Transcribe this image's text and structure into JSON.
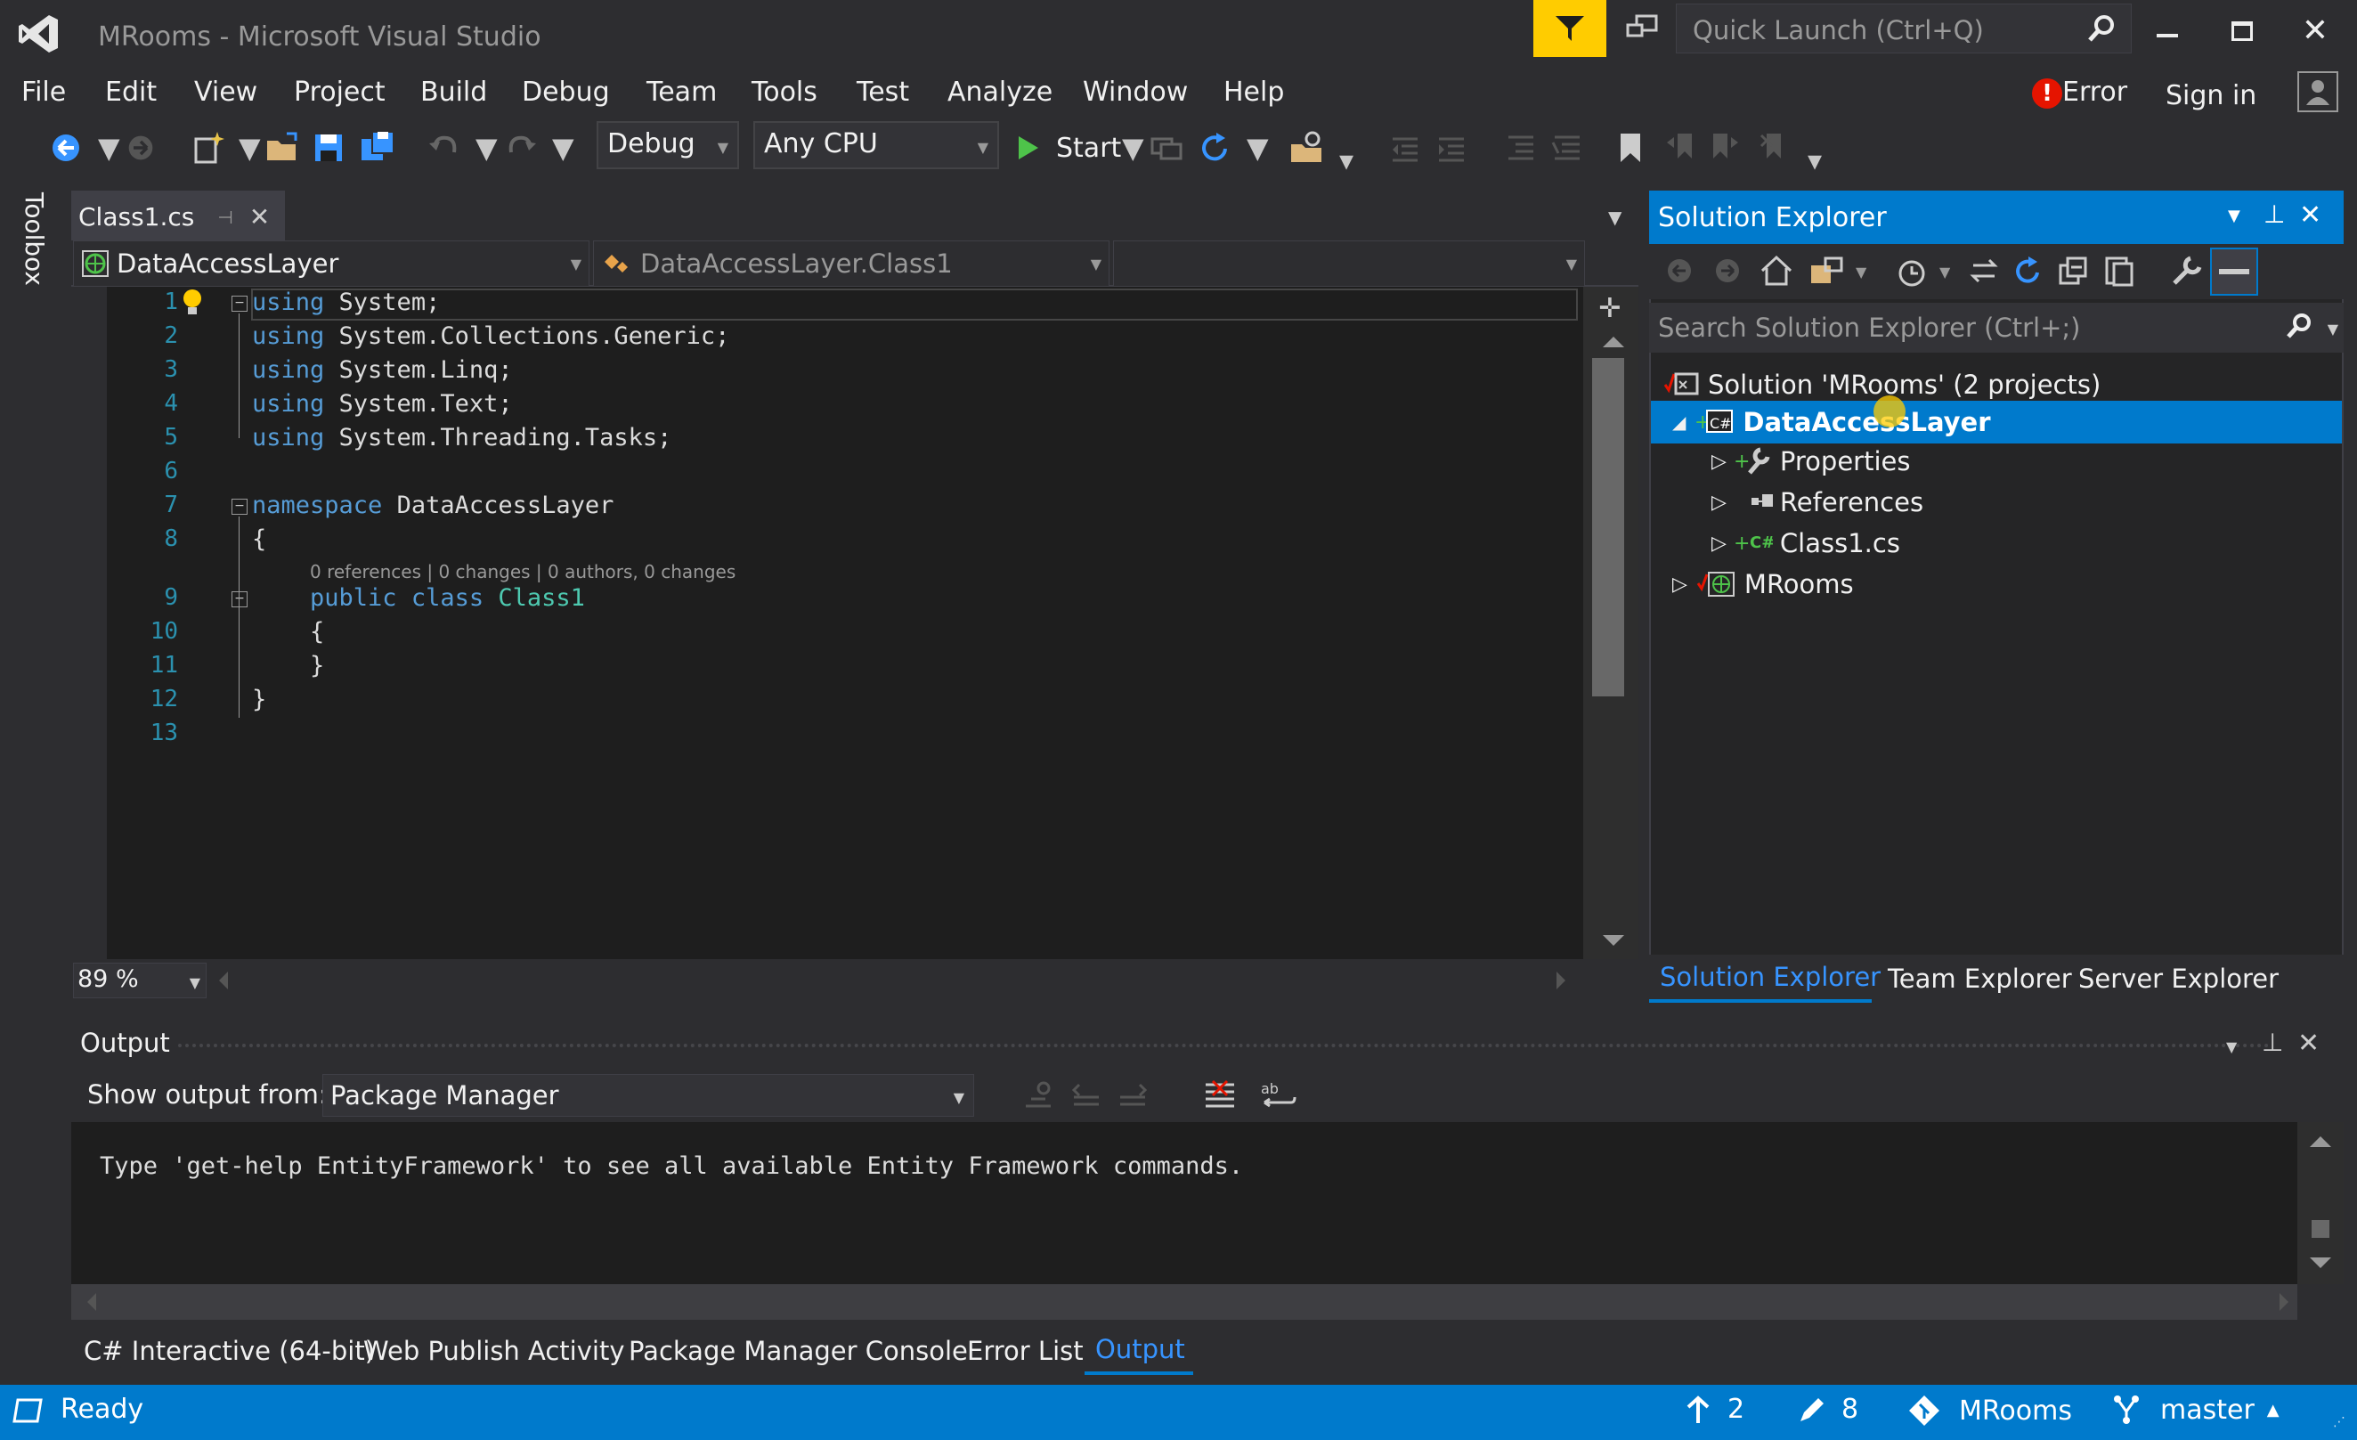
{
  "window": {
    "title": "MRooms - Microsoft Visual Studio"
  },
  "quick_launch": {
    "placeholder": "Quick Launch (Ctrl+Q)"
  },
  "menu": [
    "File",
    "Edit",
    "View",
    "Project",
    "Build",
    "Debug",
    "Team",
    "Tools",
    "Test",
    "Analyze",
    "Window",
    "Help"
  ],
  "account": {
    "error_label": "Error",
    "sign_in": "Sign in"
  },
  "toolbar": {
    "configuration": "Debug",
    "platform": "Any CPU",
    "start_label": "Start"
  },
  "toolbox": {
    "label": "Toolbox"
  },
  "editor": {
    "tab": "Class1.cs",
    "nav_project": "DataAccessLayer",
    "nav_class": "DataAccessLayer.Class1",
    "zoom": "89 %",
    "line_numbers": [
      "1",
      "2",
      "3",
      "4",
      "5",
      "6",
      "7",
      "8",
      "9",
      "10",
      "11",
      "12",
      "13"
    ],
    "lines": {
      "l1": {
        "kw": "using",
        "rest": " System;"
      },
      "l2": {
        "kw": "using",
        "rest": " System.Collections.Generic;"
      },
      "l3": {
        "kw": "using",
        "rest": " System.Linq;"
      },
      "l4": {
        "kw": "using",
        "rest": " System.Text;"
      },
      "l5": {
        "kw": "using",
        "rest": " System.Threading.Tasks;"
      },
      "l7": {
        "kw": "namespace",
        "rest": " DataAccessLayer"
      },
      "l8": "{",
      "codelens": "0 references | 0 changes | 0 authors, 0 changes",
      "l9": {
        "kw1": "public",
        "kw2": "class",
        "type": "Class1"
      },
      "l10": "{",
      "l11": "}",
      "l12": "}"
    }
  },
  "solution_explorer": {
    "title": "Solution Explorer",
    "search_placeholder": "Search Solution Explorer (Ctrl+;)",
    "solution": "Solution 'MRooms' (2 projects)",
    "project1": "DataAccessLayer",
    "properties": "Properties",
    "references": "References",
    "class_file": "Class1.cs",
    "project2": "MRooms",
    "tabs": [
      "Solution Explorer",
      "Team Explorer",
      "Server Explorer"
    ]
  },
  "output": {
    "title": "Output",
    "show_from_label": "Show output from:",
    "source": "Package Manager",
    "text": "Type 'get-help EntityFramework' to see all available Entity Framework commands."
  },
  "bottom_tabs": [
    "C# Interactive (64-bit)",
    "Web Publish Activity",
    "Package Manager Console",
    "Error List",
    "Output"
  ],
  "status": {
    "ready": "Ready",
    "up_count": "2",
    "pencil_count": "8",
    "repo": "MRooms",
    "branch": "master"
  },
  "colors": {
    "accent": "#007acc",
    "background": "#2d2d30",
    "editor_bg": "#1e1e1e",
    "keyword": "#569cd6",
    "type": "#4ec9b0",
    "linenum": "#2b91af",
    "feedback": "#ffcc00"
  }
}
